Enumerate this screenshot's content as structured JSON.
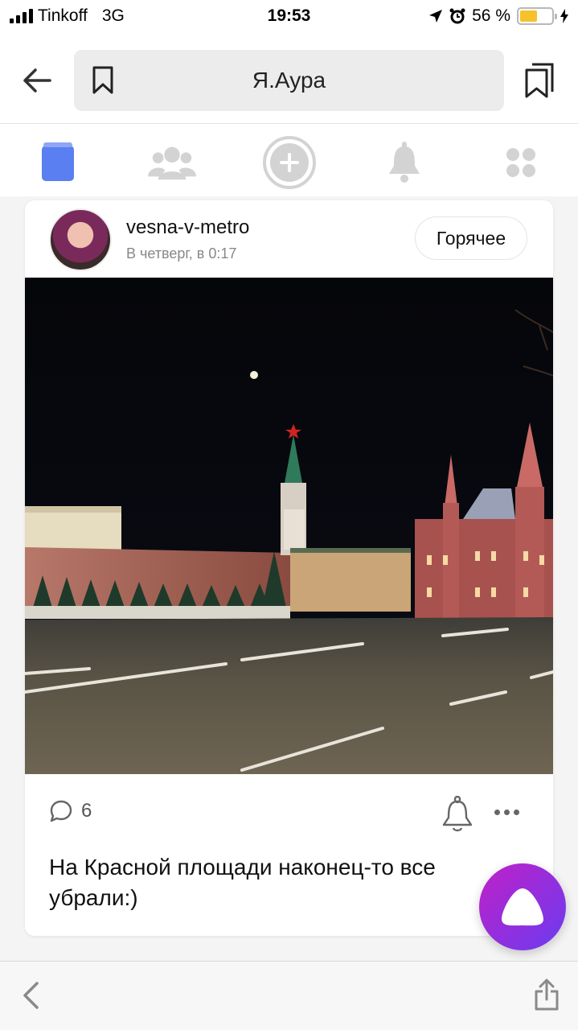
{
  "status_bar": {
    "carrier": "Tinkoff",
    "network": "3G",
    "time": "19:53",
    "battery": "56 %",
    "battery_level": 0.56
  },
  "browser": {
    "title": "Я.Аура"
  },
  "post": {
    "username": "vesna-v-metro",
    "time": "В четверг, в 0:17",
    "badge": "Горячее",
    "comments_count": "6",
    "caption": "На Красной площади наконец-то все убрали:)"
  },
  "colors": {
    "accent": "#5a7ff0",
    "battery": "#f6c22c",
    "alice_start": "#c020c8",
    "alice_end": "#6a3cf0"
  },
  "icons": {
    "nav": [
      "feed-icon",
      "people-icon",
      "add-icon",
      "bell-icon",
      "apps-icon"
    ]
  }
}
